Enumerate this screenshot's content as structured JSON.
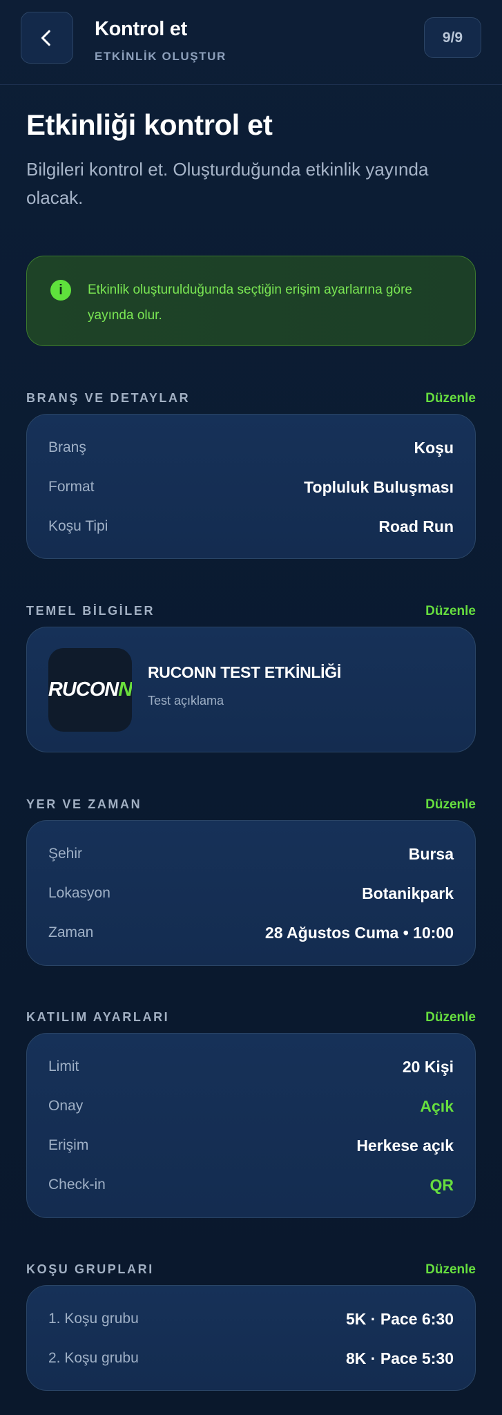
{
  "header": {
    "title": "Kontrol et",
    "subtitle": "ETKİNLİK OLUŞTUR",
    "step": "9/9",
    "back_icon": "chevron-left-icon"
  },
  "intro": {
    "title": "Etkinliği kontrol et",
    "description": "Bilgileri kontrol et. Oluşturduğunda etkinlik yayında olacak."
  },
  "notice": {
    "icon": "info-icon",
    "icon_glyph": "i",
    "text": "Etkinlik oluşturulduğunda seçtiğin erişim ayarlarına göre yayında olur."
  },
  "sections": {
    "branch": {
      "label": "BRANŞ VE DETAYLAR",
      "edit": "Düzenle",
      "rows": [
        {
          "key": "Branş",
          "value": "Koşu"
        },
        {
          "key": "Format",
          "value": "Topluluk Buluşması"
        },
        {
          "key": "Koşu Tipi",
          "value": "Road Run"
        }
      ]
    },
    "basic": {
      "label": "TEMEL BİLGİLER",
      "edit": "Düzenle",
      "logo_text": "RUCON",
      "logo_accent": "N",
      "event_name": "RUCONN TEST ETKİNLİĞİ",
      "event_desc": "Test açıklama"
    },
    "place_time": {
      "label": "YER VE ZAMAN",
      "edit": "Düzenle",
      "rows": [
        {
          "key": "Şehir",
          "value": "Bursa"
        },
        {
          "key": "Lokasyon",
          "value": "Botanikpark"
        },
        {
          "key": "Zaman",
          "value": "28 Ağustos Cuma • 10:00"
        }
      ]
    },
    "participation": {
      "label": "KATILIM AYARLARI",
      "edit": "Düzenle",
      "rows": [
        {
          "key": "Limit",
          "value": "20 Kişi"
        },
        {
          "key": "Onay",
          "value": "Açık"
        },
        {
          "key": "Erişim",
          "value": "Herkese açık"
        },
        {
          "key": "Check-in",
          "value": "QR"
        }
      ]
    },
    "groups": {
      "label": "KOŞU GRUPLARI",
      "edit": "Düzenle",
      "rows": [
        {
          "key": "1. Koşu grubu",
          "value": "5K · Pace 6:30"
        },
        {
          "key": "2. Koşu grubu",
          "value": "8K · Pace 5:30"
        }
      ]
    }
  },
  "colors": {
    "background": "#0b1a2f",
    "card": "#15305a",
    "accent_green": "#66dd3f",
    "notice_bg": "#1e4327"
  }
}
